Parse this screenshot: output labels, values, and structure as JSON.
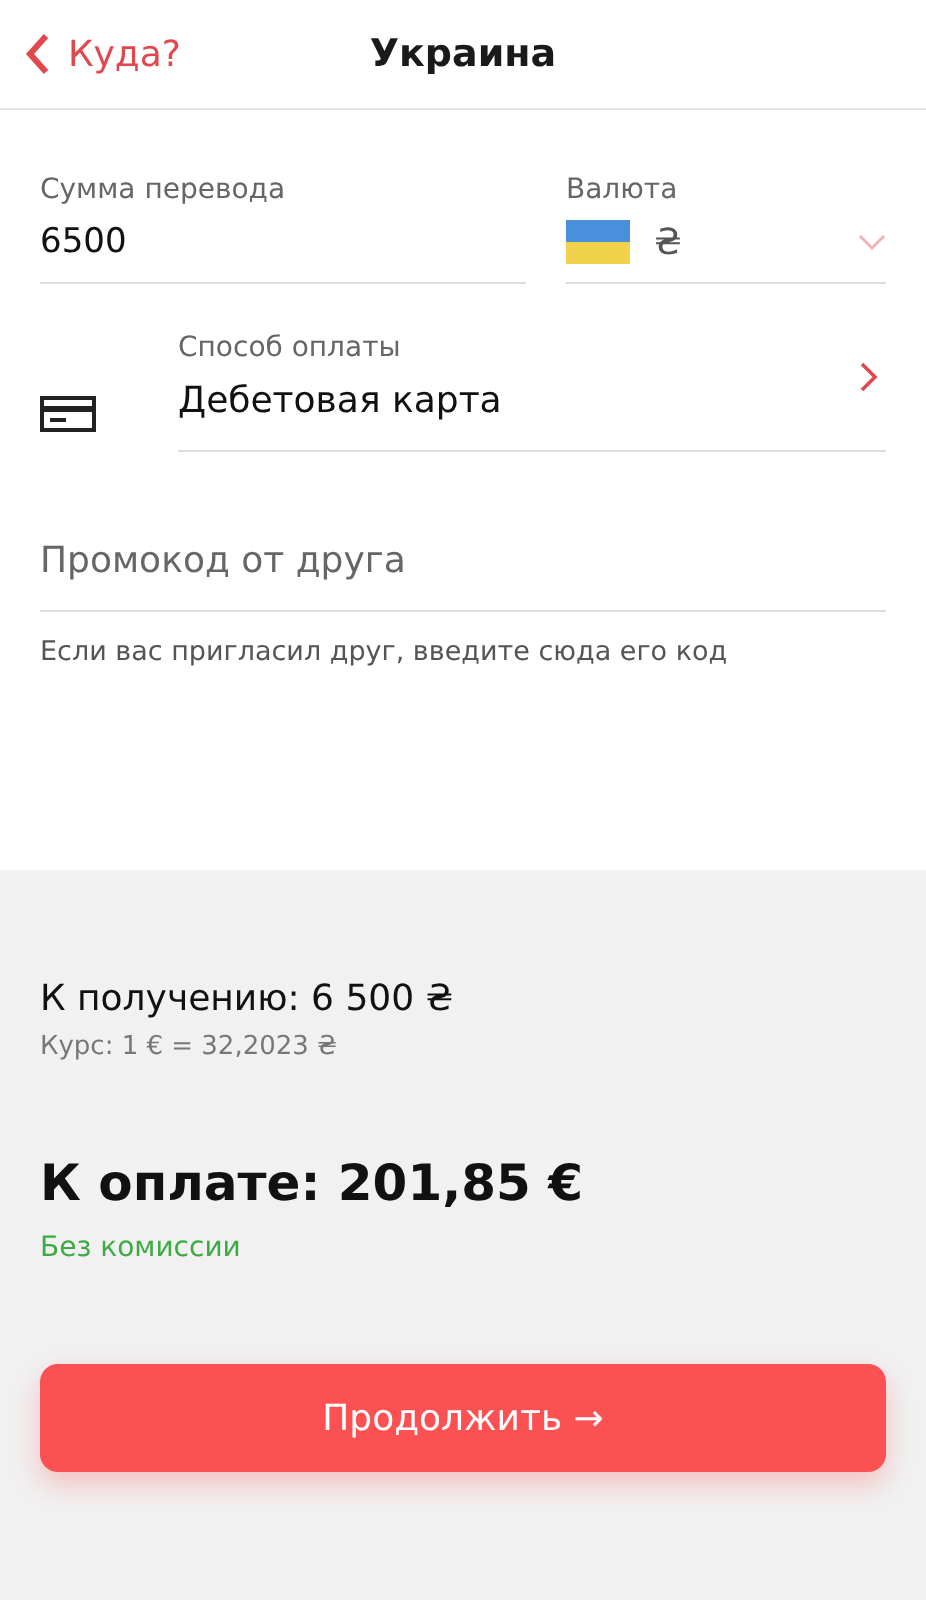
{
  "header": {
    "back_label": "Куда?",
    "title": "Украина"
  },
  "amount": {
    "label": "Сумма перевода",
    "value": "6500"
  },
  "currency": {
    "label": "Валюта",
    "value": "₴"
  },
  "payment_method": {
    "label": "Способ оплаты",
    "value": "Дебетовая карта"
  },
  "promo": {
    "placeholder": "Промокод от друга",
    "hint": "Если вас пригласил друг, введите сюда его код"
  },
  "summary": {
    "receive": "К получению: 6 500 ₴",
    "rate": "Курс: 1 € = 32,2023 ₴",
    "pay": "К оплате: 201,85 €",
    "fee_note": "Без комиссии"
  },
  "continue_button": "Продолжить →"
}
